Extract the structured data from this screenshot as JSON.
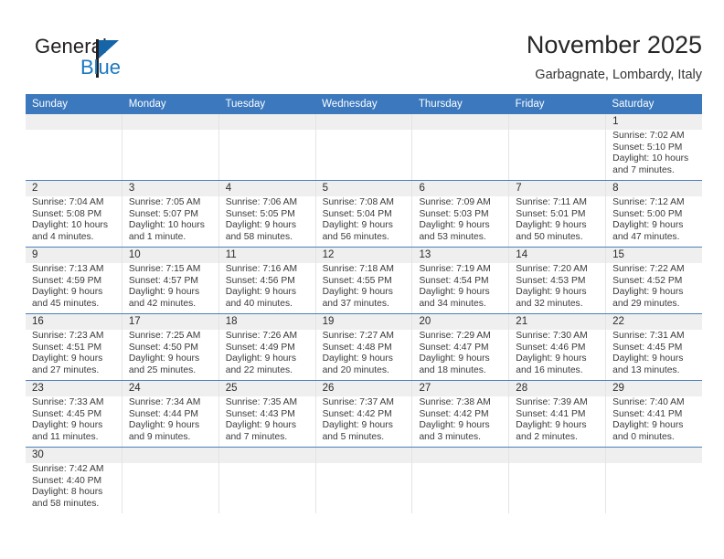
{
  "brand": {
    "name_top": "General",
    "name_bottom": "Blue",
    "triangle_color": "#1565a8",
    "text_color": "#231f20",
    "blue_color": "#1c79c0"
  },
  "header": {
    "title": "November 2025",
    "subtitle": "Garbagnate, Lombardy, Italy"
  },
  "theme": {
    "header_blue": "#3b78bd",
    "row_divider_blue": "#4a7fbe",
    "date_band_gray": "#efefef"
  },
  "weekdays": [
    "Sunday",
    "Monday",
    "Tuesday",
    "Wednesday",
    "Thursday",
    "Friday",
    "Saturday"
  ],
  "weeks": [
    [
      {
        "day": "",
        "sunrise": "",
        "sunset": "",
        "daylight_line1": "",
        "daylight_line2": ""
      },
      {
        "day": "",
        "sunrise": "",
        "sunset": "",
        "daylight_line1": "",
        "daylight_line2": ""
      },
      {
        "day": "",
        "sunrise": "",
        "sunset": "",
        "daylight_line1": "",
        "daylight_line2": ""
      },
      {
        "day": "",
        "sunrise": "",
        "sunset": "",
        "daylight_line1": "",
        "daylight_line2": ""
      },
      {
        "day": "",
        "sunrise": "",
        "sunset": "",
        "daylight_line1": "",
        "daylight_line2": ""
      },
      {
        "day": "",
        "sunrise": "",
        "sunset": "",
        "daylight_line1": "",
        "daylight_line2": ""
      },
      {
        "day": "1",
        "sunrise": "Sunrise: 7:02 AM",
        "sunset": "Sunset: 5:10 PM",
        "daylight_line1": "Daylight: 10 hours",
        "daylight_line2": "and 7 minutes."
      }
    ],
    [
      {
        "day": "2",
        "sunrise": "Sunrise: 7:04 AM",
        "sunset": "Sunset: 5:08 PM",
        "daylight_line1": "Daylight: 10 hours",
        "daylight_line2": "and 4 minutes."
      },
      {
        "day": "3",
        "sunrise": "Sunrise: 7:05 AM",
        "sunset": "Sunset: 5:07 PM",
        "daylight_line1": "Daylight: 10 hours",
        "daylight_line2": "and 1 minute."
      },
      {
        "day": "4",
        "sunrise": "Sunrise: 7:06 AM",
        "sunset": "Sunset: 5:05 PM",
        "daylight_line1": "Daylight: 9 hours",
        "daylight_line2": "and 58 minutes."
      },
      {
        "day": "5",
        "sunrise": "Sunrise: 7:08 AM",
        "sunset": "Sunset: 5:04 PM",
        "daylight_line1": "Daylight: 9 hours",
        "daylight_line2": "and 56 minutes."
      },
      {
        "day": "6",
        "sunrise": "Sunrise: 7:09 AM",
        "sunset": "Sunset: 5:03 PM",
        "daylight_line1": "Daylight: 9 hours",
        "daylight_line2": "and 53 minutes."
      },
      {
        "day": "7",
        "sunrise": "Sunrise: 7:11 AM",
        "sunset": "Sunset: 5:01 PM",
        "daylight_line1": "Daylight: 9 hours",
        "daylight_line2": "and 50 minutes."
      },
      {
        "day": "8",
        "sunrise": "Sunrise: 7:12 AM",
        "sunset": "Sunset: 5:00 PM",
        "daylight_line1": "Daylight: 9 hours",
        "daylight_line2": "and 47 minutes."
      }
    ],
    [
      {
        "day": "9",
        "sunrise": "Sunrise: 7:13 AM",
        "sunset": "Sunset: 4:59 PM",
        "daylight_line1": "Daylight: 9 hours",
        "daylight_line2": "and 45 minutes."
      },
      {
        "day": "10",
        "sunrise": "Sunrise: 7:15 AM",
        "sunset": "Sunset: 4:57 PM",
        "daylight_line1": "Daylight: 9 hours",
        "daylight_line2": "and 42 minutes."
      },
      {
        "day": "11",
        "sunrise": "Sunrise: 7:16 AM",
        "sunset": "Sunset: 4:56 PM",
        "daylight_line1": "Daylight: 9 hours",
        "daylight_line2": "and 40 minutes."
      },
      {
        "day": "12",
        "sunrise": "Sunrise: 7:18 AM",
        "sunset": "Sunset: 4:55 PM",
        "daylight_line1": "Daylight: 9 hours",
        "daylight_line2": "and 37 minutes."
      },
      {
        "day": "13",
        "sunrise": "Sunrise: 7:19 AM",
        "sunset": "Sunset: 4:54 PM",
        "daylight_line1": "Daylight: 9 hours",
        "daylight_line2": "and 34 minutes."
      },
      {
        "day": "14",
        "sunrise": "Sunrise: 7:20 AM",
        "sunset": "Sunset: 4:53 PM",
        "daylight_line1": "Daylight: 9 hours",
        "daylight_line2": "and 32 minutes."
      },
      {
        "day": "15",
        "sunrise": "Sunrise: 7:22 AM",
        "sunset": "Sunset: 4:52 PM",
        "daylight_line1": "Daylight: 9 hours",
        "daylight_line2": "and 29 minutes."
      }
    ],
    [
      {
        "day": "16",
        "sunrise": "Sunrise: 7:23 AM",
        "sunset": "Sunset: 4:51 PM",
        "daylight_line1": "Daylight: 9 hours",
        "daylight_line2": "and 27 minutes."
      },
      {
        "day": "17",
        "sunrise": "Sunrise: 7:25 AM",
        "sunset": "Sunset: 4:50 PM",
        "daylight_line1": "Daylight: 9 hours",
        "daylight_line2": "and 25 minutes."
      },
      {
        "day": "18",
        "sunrise": "Sunrise: 7:26 AM",
        "sunset": "Sunset: 4:49 PM",
        "daylight_line1": "Daylight: 9 hours",
        "daylight_line2": "and 22 minutes."
      },
      {
        "day": "19",
        "sunrise": "Sunrise: 7:27 AM",
        "sunset": "Sunset: 4:48 PM",
        "daylight_line1": "Daylight: 9 hours",
        "daylight_line2": "and 20 minutes."
      },
      {
        "day": "20",
        "sunrise": "Sunrise: 7:29 AM",
        "sunset": "Sunset: 4:47 PM",
        "daylight_line1": "Daylight: 9 hours",
        "daylight_line2": "and 18 minutes."
      },
      {
        "day": "21",
        "sunrise": "Sunrise: 7:30 AM",
        "sunset": "Sunset: 4:46 PM",
        "daylight_line1": "Daylight: 9 hours",
        "daylight_line2": "and 16 minutes."
      },
      {
        "day": "22",
        "sunrise": "Sunrise: 7:31 AM",
        "sunset": "Sunset: 4:45 PM",
        "daylight_line1": "Daylight: 9 hours",
        "daylight_line2": "and 13 minutes."
      }
    ],
    [
      {
        "day": "23",
        "sunrise": "Sunrise: 7:33 AM",
        "sunset": "Sunset: 4:45 PM",
        "daylight_line1": "Daylight: 9 hours",
        "daylight_line2": "and 11 minutes."
      },
      {
        "day": "24",
        "sunrise": "Sunrise: 7:34 AM",
        "sunset": "Sunset: 4:44 PM",
        "daylight_line1": "Daylight: 9 hours",
        "daylight_line2": "and 9 minutes."
      },
      {
        "day": "25",
        "sunrise": "Sunrise: 7:35 AM",
        "sunset": "Sunset: 4:43 PM",
        "daylight_line1": "Daylight: 9 hours",
        "daylight_line2": "and 7 minutes."
      },
      {
        "day": "26",
        "sunrise": "Sunrise: 7:37 AM",
        "sunset": "Sunset: 4:42 PM",
        "daylight_line1": "Daylight: 9 hours",
        "daylight_line2": "and 5 minutes."
      },
      {
        "day": "27",
        "sunrise": "Sunrise: 7:38 AM",
        "sunset": "Sunset: 4:42 PM",
        "daylight_line1": "Daylight: 9 hours",
        "daylight_line2": "and 3 minutes."
      },
      {
        "day": "28",
        "sunrise": "Sunrise: 7:39 AM",
        "sunset": "Sunset: 4:41 PM",
        "daylight_line1": "Daylight: 9 hours",
        "daylight_line2": "and 2 minutes."
      },
      {
        "day": "29",
        "sunrise": "Sunrise: 7:40 AM",
        "sunset": "Sunset: 4:41 PM",
        "daylight_line1": "Daylight: 9 hours",
        "daylight_line2": "and 0 minutes."
      }
    ],
    [
      {
        "day": "30",
        "sunrise": "Sunrise: 7:42 AM",
        "sunset": "Sunset: 4:40 PM",
        "daylight_line1": "Daylight: 8 hours",
        "daylight_line2": "and 58 minutes."
      },
      {
        "day": "",
        "sunrise": "",
        "sunset": "",
        "daylight_line1": "",
        "daylight_line2": ""
      },
      {
        "day": "",
        "sunrise": "",
        "sunset": "",
        "daylight_line1": "",
        "daylight_line2": ""
      },
      {
        "day": "",
        "sunrise": "",
        "sunset": "",
        "daylight_line1": "",
        "daylight_line2": ""
      },
      {
        "day": "",
        "sunrise": "",
        "sunset": "",
        "daylight_line1": "",
        "daylight_line2": ""
      },
      {
        "day": "",
        "sunrise": "",
        "sunset": "",
        "daylight_line1": "",
        "daylight_line2": ""
      },
      {
        "day": "",
        "sunrise": "",
        "sunset": "",
        "daylight_line1": "",
        "daylight_line2": ""
      }
    ]
  ]
}
